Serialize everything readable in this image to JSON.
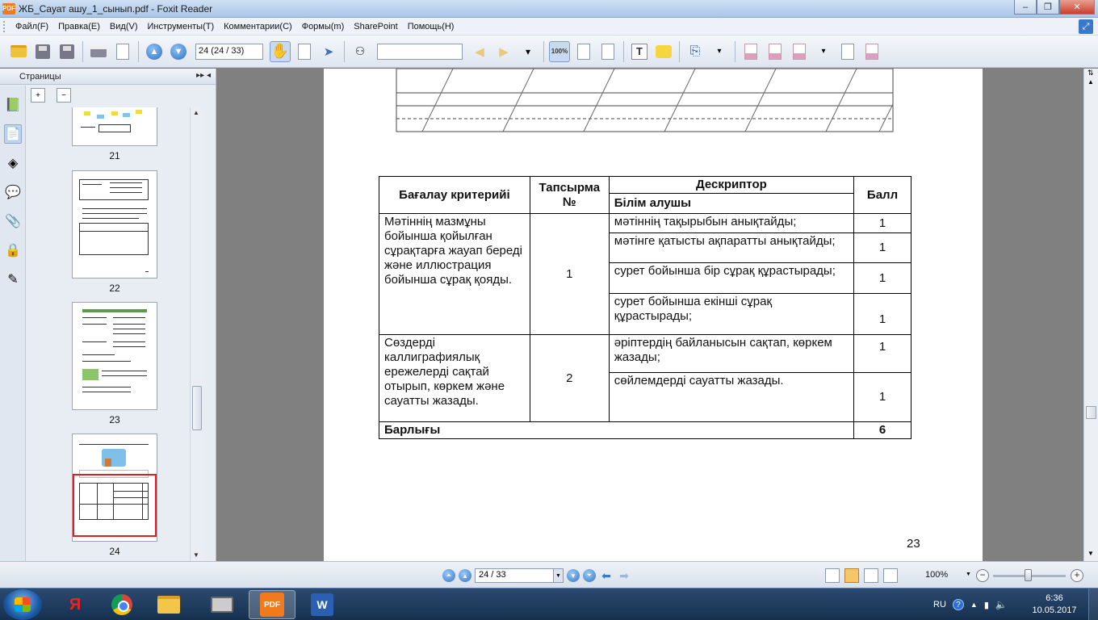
{
  "window": {
    "title": "ЖБ_Сауат ашу_1_сынып.pdf - Foxit Reader",
    "app_icon_text": "PDF",
    "minimize": "–",
    "maximize": "❐",
    "close": "✕"
  },
  "menu": {
    "items": [
      "Файл(F)",
      "Правка(E)",
      "Вид(V)",
      "Инструменты(T)",
      "Комментарии(C)",
      "Формы(m)",
      "SharePoint",
      "Помощь(H)"
    ]
  },
  "toolbar": {
    "page_field": "24 (24 / 33)",
    "search_field": "",
    "zoom_icon_text": "100%"
  },
  "left_panel": {
    "title": "Страницы",
    "collapse_controls": "▸▸ ◂",
    "thumbnails": [
      {
        "label": "21"
      },
      {
        "label": "22"
      },
      {
        "label": "23"
      },
      {
        "label": "24"
      }
    ]
  },
  "document": {
    "table": {
      "headers": {
        "criteria": "Бағалау критерийі",
        "task_no": "Тапсырма №",
        "descriptor": "Дескриптор",
        "learner": "Білім алушы",
        "score": "Балл"
      },
      "groups": [
        {
          "criteria": "Мәтіннің мазмұны бойынша қойылған сұрақтарға жауап береді және иллюстрация бойынша сұрақ қояды.",
          "task_no": "1",
          "rows": [
            {
              "descriptor": "мәтіннің тақырыбын анықтайды;",
              "score": "1"
            },
            {
              "descriptor": "мәтінге қатысты ақпаратты анықтайды;",
              "score": "1"
            },
            {
              "descriptor": "сурет бойынша бір сұрақ құрастырады;",
              "score": "1"
            },
            {
              "descriptor": "сурет бойынша екінші сұрақ құрастырады;",
              "score": "1"
            }
          ]
        },
        {
          "criteria": "Сөздерді каллиграфиялық ережелерді сақтай отырып, көркем және сауатты жазады.",
          "task_no": "2",
          "rows": [
            {
              "descriptor": "әріптердің байланысын сақтап, көркем жазады;",
              "score": "1"
            },
            {
              "descriptor": "сөйлемдерді сауатты жазады.",
              "score": "1"
            }
          ]
        }
      ],
      "total_label": "Барлығы",
      "total_score": "6"
    },
    "page_number": "23"
  },
  "statusbar": {
    "page_field": "24 / 33",
    "zoom": "100%"
  },
  "taskbar": {
    "yandex_label": "Я",
    "pdf_label": "PDF",
    "word_label": "W",
    "language": "RU",
    "time": "6:36",
    "date": "10.05.2017"
  }
}
